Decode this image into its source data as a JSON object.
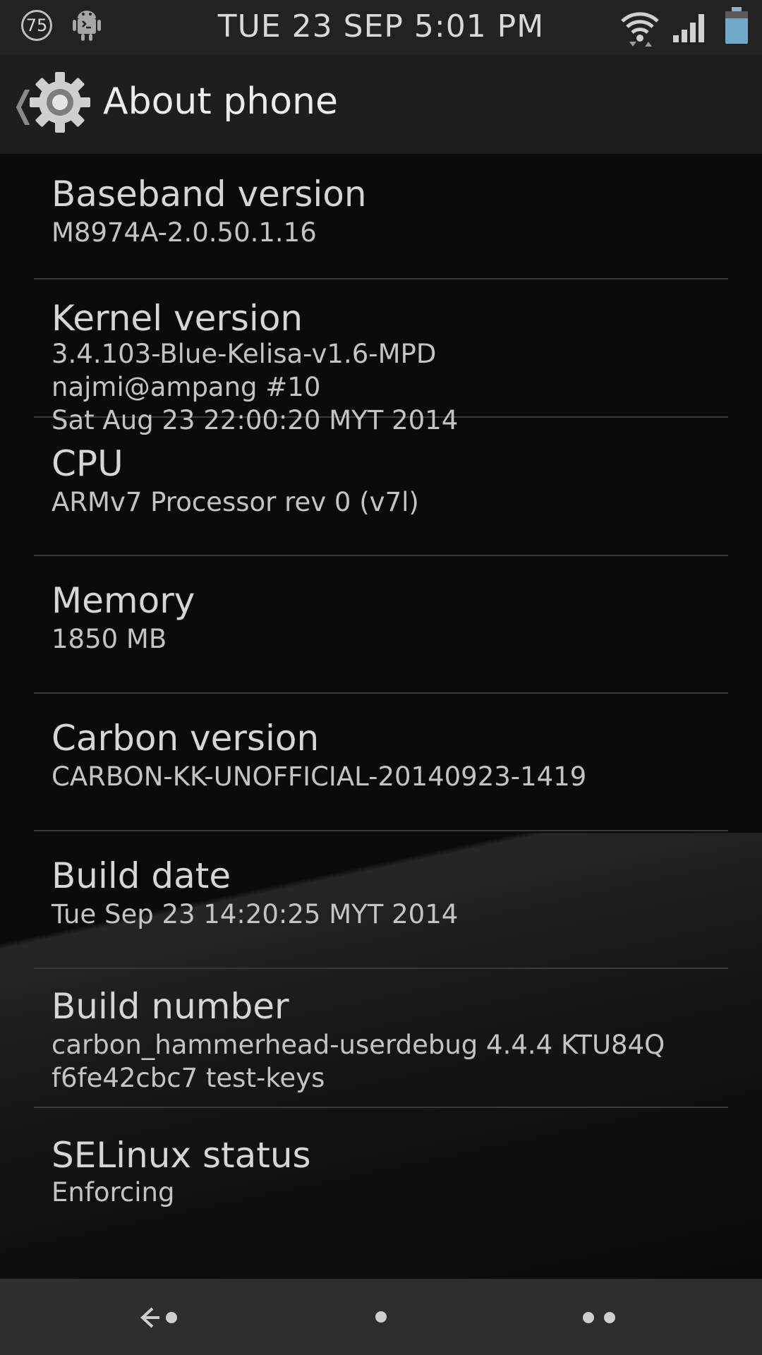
{
  "status_bar": {
    "notification_count": "75",
    "clock": "TUE 23 SEP 5:01 PM",
    "icons": [
      "notification-badge-icon",
      "android-debug-icon",
      "wifi-icon",
      "cell-signal-icon",
      "battery-icon"
    ]
  },
  "action_bar": {
    "title": "About phone",
    "up_icon": "chevron-left-icon",
    "app_icon": "settings-gear-icon"
  },
  "items": [
    {
      "label": "Baseband version",
      "value": "M8974A-2.0.50.1.16"
    },
    {
      "label": "Kernel version",
      "value": "3.4.103-Blue-Kelisa-v1.6-MPD\nnajmi@ampang #10\nSat Aug 23 22:00:20 MYT 2014"
    },
    {
      "label": "CPU",
      "value": "ARMv7 Processor rev 0 (v7l)"
    },
    {
      "label": "Memory",
      "value": "1850 MB"
    },
    {
      "label": "Carbon version",
      "value": "CARBON-KK-UNOFFICIAL-20140923-1419"
    },
    {
      "label": "Build date",
      "value": "Tue Sep 23 14:20:25 MYT 2014"
    },
    {
      "label": "Build number",
      "value": "carbon_hammerhead-userdebug 4.4.4 KTU84Q\nf6fe42cbc7 test-keys"
    },
    {
      "label": "SELinux status",
      "value": "Enforcing"
    }
  ],
  "nav_bar": {
    "icons": [
      "back-icon",
      "home-icon",
      "recents-icon"
    ]
  },
  "colors": {
    "background": "#0a0a0a",
    "status_bar": "#222222",
    "action_bar": "#1e1e1e",
    "nav_bar": "#2e2e2e",
    "divider": "#3a3a3a",
    "text_primary": "#d6d6d6",
    "text_secondary": "#c4c4c4"
  }
}
